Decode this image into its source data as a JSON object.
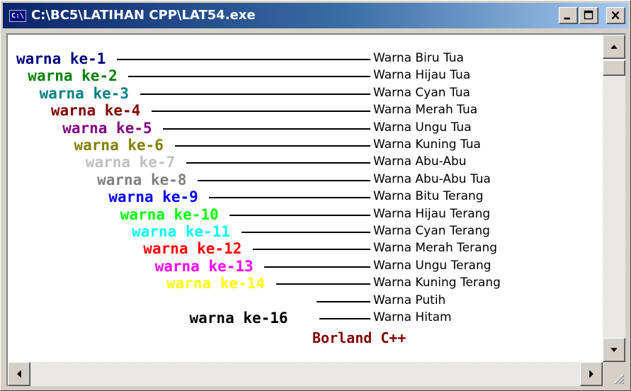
{
  "window": {
    "title": "C:\\BC5\\LATIHAN CPP\\LAT54.exe",
    "icon_text": "C:\\"
  },
  "console": {
    "rows": [
      {
        "label": "warna ke-1",
        "color": "#000080",
        "name": "Warna Biru Tua"
      },
      {
        "label": "warna ke-2",
        "color": "#008000",
        "name": "Warna Hijau Tua"
      },
      {
        "label": "warna ke-3",
        "color": "#008080",
        "name": "Warna Cyan Tua"
      },
      {
        "label": "warna ke-4",
        "color": "#800000",
        "name": "Warna Merah Tua"
      },
      {
        "label": "warna ke-5",
        "color": "#800080",
        "name": "Warna Ungu Tua"
      },
      {
        "label": "warna ke-6",
        "color": "#808000",
        "name": "Warna Kuning Tua"
      },
      {
        "label": "warna ke-7",
        "color": "#c0c0c0",
        "name": "Warna Abu-Abu"
      },
      {
        "label": "warna ke-8",
        "color": "#808080",
        "name": "Warna Abu-Abu Tua"
      },
      {
        "label": "warna ke-9",
        "color": "#0000ff",
        "name": "Warna Bitu Terang"
      },
      {
        "label": "warna ke-10",
        "color": "#00ff00",
        "name": "Warna Hijau Terang"
      },
      {
        "label": "warna ke-11",
        "color": "#00ffff",
        "name": "Warna Cyan Terang"
      },
      {
        "label": "warna ke-12",
        "color": "#ff0000",
        "name": "Warna Merah Terang"
      },
      {
        "label": "warna ke-13",
        "color": "#ff00ff",
        "name": "Warna Ungu Terang"
      },
      {
        "label": "warna ke-14",
        "color": "#ffff00",
        "name": "Warna Kuning Terang"
      },
      {
        "label": "",
        "color": "#ffffff",
        "name": "Warna Putih"
      },
      {
        "label": "warna ke-16",
        "color": "#000000",
        "name": "Warna Hitam"
      }
    ],
    "footer": "Borland C++",
    "footer_color": "#800000"
  },
  "icons": {
    "minimize": "minimize-icon",
    "maximize": "maximize-icon",
    "close": "close-icon",
    "scroll_up": "arrow-up-icon",
    "scroll_down": "arrow-down-icon",
    "scroll_left": "arrow-left-icon",
    "scroll_right": "arrow-right-icon",
    "resize": "resize-grip-icon"
  }
}
